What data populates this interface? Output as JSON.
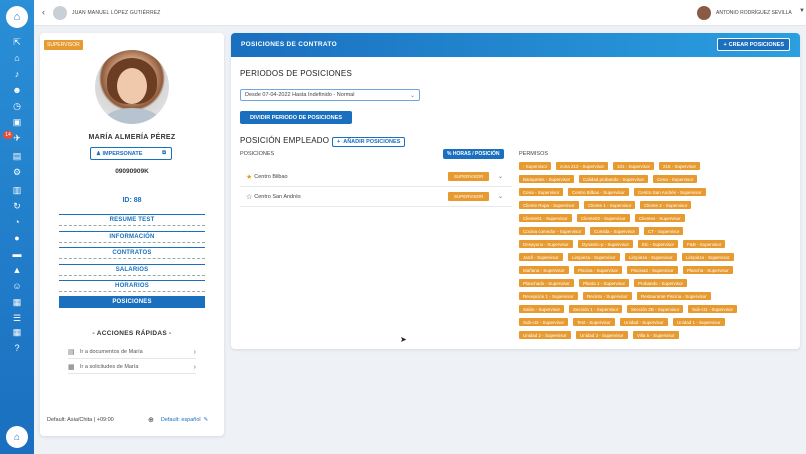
{
  "topbar": {
    "left_user": "JUAN MANUEL LÓPEZ GUTIÉRREZ",
    "right_user": "ANTONIO RODRÍGUEZ SEVILLA"
  },
  "sidebar": {
    "badge_count": "14",
    "icons": [
      "home-icon",
      "bell-icon",
      "users-icon",
      "clock-icon",
      "briefcase-icon",
      "airplane-icon",
      "id-card-icon",
      "gear-icon",
      "document-icon",
      "clock-refresh-icon",
      "chart-icon",
      "chat-icon",
      "folder-icon",
      "graduation-icon",
      "person-settings-icon",
      "building-icon",
      "list-icon",
      "grid-icon",
      "help-icon"
    ]
  },
  "profile": {
    "role_badge": "SUPERVISOR",
    "name": "MARÍA ALMERÍA PÉREZ",
    "impersonate_label": "IMPERSONATE",
    "document_number": "09090909K",
    "id_label": "ID: 88",
    "menu": [
      {
        "label": "RESUME TEST",
        "active": false
      },
      {
        "label": "INFORMACIÓN",
        "active": false
      },
      {
        "label": "CONTRATOS",
        "active": false
      },
      {
        "label": "SALARIOS",
        "active": false
      },
      {
        "label": "HORARIOS",
        "active": false
      },
      {
        "label": "POSICIONES",
        "active": true
      }
    ],
    "quick_actions_title": "- ACCIONES RÁPIDAS -",
    "quick_actions": [
      {
        "label": "Ir a documentos de María"
      },
      {
        "label": "Ir a solicitudes de María"
      }
    ],
    "footer_timezone": "Default: Asia/Chita | +09:00",
    "footer_language": "Default: español"
  },
  "main": {
    "title": "POSICIONES DE CONTRATO",
    "create_label": "CREAR POSICIONES",
    "periods_title": "PERIODOS DE POSICIONES",
    "period_value": "Desde 07-04-2022 Hasta Indefinido - Normal",
    "divide_label": "DIVIDIR PERIODO DE POSICIONES",
    "position_title": "POSICIÓN EMPLEADO",
    "add_positions_label": "AÑADIR POSICIONES",
    "col_positions": "POSICIONES",
    "hours_label": "% HORAS / POSICIÓN",
    "col_permissions": "PERMISOS",
    "positions": [
      {
        "name": "Centro Bilbao",
        "tag": "SUPERVISOR",
        "primary": true
      },
      {
        "name": "Centro San Andrés",
        "tag": "SUPERVISOR",
        "primary": false
      }
    ],
    "permissions": [
      [
        "- Supervisor",
        "zona 212 - Supervisor",
        "101 - Supervisor",
        "215 - Supervisor"
      ],
      [
        "Banquetes - Supervisor",
        "Calidad probando - Supervisor",
        "Cena - Supervisor"
      ],
      [
        "Cena - Supervisor",
        "Centro Bilbao - Supervisor",
        "Centro San Andrés - Supervisor"
      ],
      [
        "Cliente Ropa - Supervisor",
        "Cliente 1 - Supervisor",
        "Cliente 2 - Supervisor"
      ],
      [
        "Cliente01 - Supervisor",
        "Cliente02 - Supervisor",
        "Clientes - Supervisor"
      ],
      [
        "Cocina comedor - Supervisor",
        "Comida - Supervisor",
        "CT - Supervisor"
      ],
      [
        "Desayuno - Supervisor",
        "Dynamic-p - Supervisor",
        "Etc - Supervisor",
        "F&B - Supervisor"
      ],
      [
        "Jardí - Supervisor",
        "Limpieza - Supervisor",
        "Limpieza - Supervisor",
        "Limpieza - Supervisor"
      ],
      [
        "Mañana - Supervisor",
        "Piscina - Supervisor",
        "Piscina2 - Supervisor",
        "Plancha - Supervisor"
      ],
      [
        "Planchado - Supervisor",
        "Planta 1 - Supervisor",
        "Probando - Supervisor"
      ],
      [
        "Recepción 1 - Supervisor",
        "Recinto - Supervisor",
        "Restaurante Piscina - Supervisor"
      ],
      [
        "Salón - Supervisor",
        "Sección 1 - Supervisor",
        "Sección 2B - Supervisor",
        "Sub-ct1 - Supervisor"
      ],
      [
        "Sub-ct2 - Supervisor",
        "Test - Supervisor",
        "Unidad - Supervisor",
        "Unidad 1 - Supervisor"
      ],
      [
        "Unidad 2 - Supervisor",
        "Unidad 3 - Supervisor",
        "Villa 5 - Supervisor"
      ]
    ]
  },
  "colors": {
    "primary": "#1a6fbf",
    "accent": "#e79a2f",
    "background": "#eef1f5"
  }
}
